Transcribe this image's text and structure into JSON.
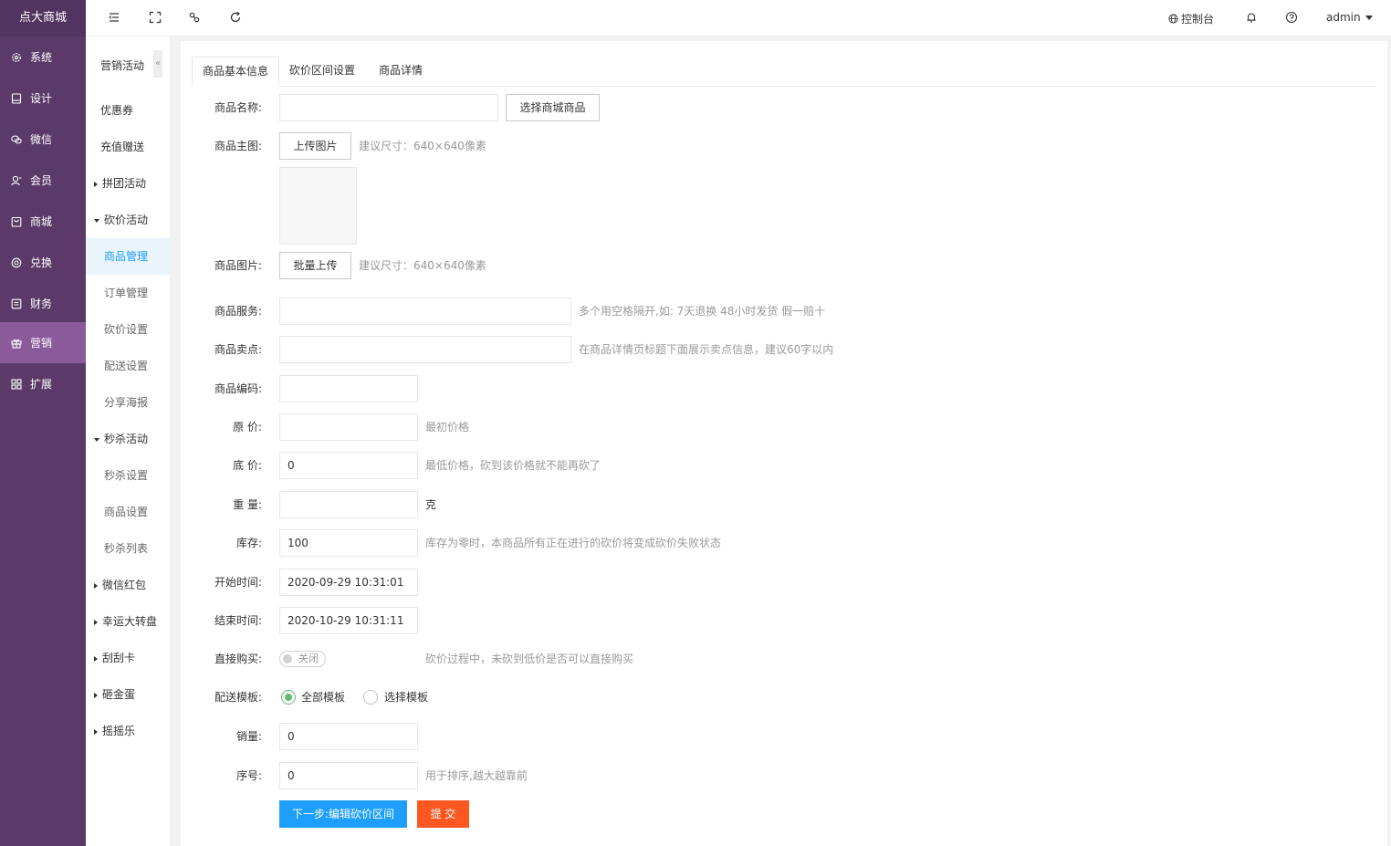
{
  "app": {
    "logo": "点大商城"
  },
  "sidebar": {
    "items": [
      {
        "label": "系统",
        "icon": "gear-icon"
      },
      {
        "label": "设计",
        "icon": "monitor-icon"
      },
      {
        "label": "微信",
        "icon": "wechat-icon"
      },
      {
        "label": "会员",
        "icon": "user-icon"
      },
      {
        "label": "商城",
        "icon": "shop-icon"
      },
      {
        "label": "兑换",
        "icon": "exchange-icon"
      },
      {
        "label": "财务",
        "icon": "finance-icon"
      },
      {
        "label": "营销",
        "icon": "gift-icon",
        "active": true
      },
      {
        "label": "扩展",
        "icon": "grid-icon"
      }
    ]
  },
  "subnav": {
    "title": "营销活动",
    "collapse_glyph": "«",
    "items": [
      {
        "label": "优惠券"
      },
      {
        "label": "充值赠送"
      },
      {
        "label": "拼团活动"
      },
      {
        "label": "砍价活动"
      },
      {
        "label": "商品管理"
      },
      {
        "label": "订单管理"
      },
      {
        "label": "砍价设置"
      },
      {
        "label": "配送设置"
      },
      {
        "label": "分享海报"
      },
      {
        "label": "秒杀活动"
      },
      {
        "label": "秒杀设置"
      },
      {
        "label": "商品设置"
      },
      {
        "label": "秒杀列表"
      },
      {
        "label": "微信红包"
      },
      {
        "label": "幸运大转盘"
      },
      {
        "label": "刮刮卡"
      },
      {
        "label": "砸金蛋"
      },
      {
        "label": "摇摇乐"
      }
    ]
  },
  "header": {
    "console_label": "控制台",
    "user_label": "admin"
  },
  "tabs": [
    "商品基本信息",
    "砍价区间设置",
    "商品详情"
  ],
  "form": {
    "name": {
      "label": "商品名称:",
      "value": "",
      "button": "选择商城商品"
    },
    "main_image": {
      "label": "商品主图:",
      "button": "上传图片",
      "hint": "建议尺寸：640×640像素"
    },
    "images": {
      "label": "商品图片:",
      "button": "批量上传",
      "hint": "建议尺寸：640×640像素"
    },
    "service": {
      "label": "商品服务:",
      "value": "",
      "hint": "多个用空格隔开,如: 7天退换 48小时发货 假一赔十"
    },
    "selling_point": {
      "label": "商品卖点:",
      "value": "",
      "hint": "在商品详情页标题下面展示卖点信息，建议60字以内"
    },
    "code": {
      "label": "商品编码:",
      "value": ""
    },
    "original_price": {
      "label": "原 价:",
      "value": "",
      "hint": "最初价格"
    },
    "floor_price": {
      "label": "底 价:",
      "value": "0",
      "hint": "最低价格，砍到该价格就不能再砍了"
    },
    "weight": {
      "label": "重 量:",
      "value": "",
      "hint": "克"
    },
    "stock": {
      "label": "库存:",
      "value": "100",
      "hint": "库存为零时，本商品所有正在进行的砍价将变成砍价失败状态"
    },
    "start_time": {
      "label": "开始时间:",
      "value": "2020-09-29 10:31:01"
    },
    "end_time": {
      "label": "结束时间:",
      "value": "2020-10-29 10:31:11"
    },
    "direct_buy": {
      "label": "直接购买:",
      "switch_text": "关闭",
      "hint": "砍价过程中，未砍到低价是否可以直接购买"
    },
    "shipping": {
      "label": "配送模板:",
      "options": [
        "全部模板",
        "选择模板"
      ],
      "selected": "全部模板"
    },
    "sales": {
      "label": "销量:",
      "value": "0"
    },
    "sort": {
      "label": "序号:",
      "value": "0",
      "hint": "用于排序,越大越靠前"
    }
  },
  "actions": {
    "next_label": "下一步:编辑砍价区间",
    "submit_label": "提 交"
  },
  "colors": {
    "sidebar": "#5b3a6a",
    "sidebar_active": "#8a5a9b",
    "primary": "#1e9fff",
    "submit": "#ff5722",
    "radio": "#5fb878"
  }
}
